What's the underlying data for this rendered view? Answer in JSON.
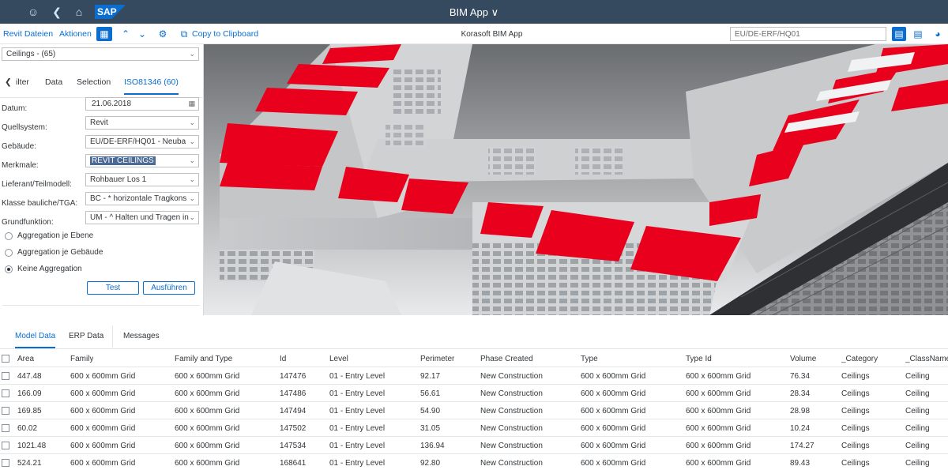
{
  "shell": {
    "app_title": "BIM App ∨",
    "logo": "SAP"
  },
  "toolbar": {
    "revit_files": "Revit Dateien",
    "actions": "Aktionen",
    "copy": "Copy to Clipboard",
    "center_title": "Korasoft BIM App",
    "search_value": "EU/DE-ERF/HQ01"
  },
  "left": {
    "category_select": "Ceilings - (65)",
    "tabs": [
      "ilter",
      "Data",
      "Selection",
      "ISO81346 (60)"
    ],
    "fields": [
      {
        "label": "Datum:",
        "value": "21.06.2018"
      },
      {
        "label": "Quellsystem:",
        "value": "Revit"
      },
      {
        "label": "Gebäude:",
        "value": "EU/DE-ERF/HQ01 - Neuba"
      },
      {
        "label": "Merkmale:",
        "value": "REVIT CEILINGS"
      },
      {
        "label": "Lieferant/Teilmodell:",
        "value": "Rohbauer Los 1"
      },
      {
        "label": "Klasse bauliche/TGA:",
        "value": "BC - * horizontale Tragkons"
      },
      {
        "label": "Grundfunktion:",
        "value": "UM - ^ Halten und Tragen in"
      }
    ],
    "radios": [
      "Aggregation je Ebene",
      "Aggregation je Gebäude",
      "Keine Aggregation"
    ],
    "buttons": {
      "test": "Test",
      "run": "Ausführen"
    }
  },
  "bottom": {
    "tabs": [
      "Model Data",
      "ERP Data",
      "Messages"
    ],
    "columns": [
      "Area",
      "Family",
      "Family and Type",
      "Id",
      "Level",
      "Perimeter",
      "Phase Created",
      "Type",
      "Type Id",
      "Volume",
      "_Category",
      "_ClassName"
    ],
    "rows": [
      [
        "447.48",
        "600 x 600mm Grid",
        "600 x 600mm Grid",
        "147476",
        "01 - Entry Level",
        "92.17",
        "New Construction",
        "600 x 600mm Grid",
        "600 x 600mm Grid",
        "76.34",
        "Ceilings",
        "Ceiling"
      ],
      [
        "166.09",
        "600 x 600mm Grid",
        "600 x 600mm Grid",
        "147486",
        "01 - Entry Level",
        "56.61",
        "New Construction",
        "600 x 600mm Grid",
        "600 x 600mm Grid",
        "28.34",
        "Ceilings",
        "Ceiling"
      ],
      [
        "169.85",
        "600 x 600mm Grid",
        "600 x 600mm Grid",
        "147494",
        "01 - Entry Level",
        "54.90",
        "New Construction",
        "600 x 600mm Grid",
        "600 x 600mm Grid",
        "28.98",
        "Ceilings",
        "Ceiling"
      ],
      [
        "60.02",
        "600 x 600mm Grid",
        "600 x 600mm Grid",
        "147502",
        "01 - Entry Level",
        "31.05",
        "New Construction",
        "600 x 600mm Grid",
        "600 x 600mm Grid",
        "10.24",
        "Ceilings",
        "Ceiling"
      ],
      [
        "1021.48",
        "600 x 600mm Grid",
        "600 x 600mm Grid",
        "147534",
        "01 - Entry Level",
        "136.94",
        "New Construction",
        "600 x 600mm Grid",
        "600 x 600mm Grid",
        "174.27",
        "Ceilings",
        "Ceiling"
      ],
      [
        "524.21",
        "600 x 600mm Grid",
        "600 x 600mm Grid",
        "168641",
        "01 - Entry Level",
        "92.80",
        "New Construction",
        "600 x 600mm Grid",
        "600 x 600mm Grid",
        "89.43",
        "Ceilings",
        "Ceiling"
      ]
    ]
  },
  "colors": {
    "shell": "#354a5f",
    "accent": "#0a6ed1",
    "highlight": "#e8001c"
  },
  "icons": [
    "user-icon",
    "back-icon",
    "home-icon",
    "grid-icon",
    "chevron-up-icon",
    "chevron-down-icon",
    "settings-icon",
    "copy-icon",
    "calendar-icon",
    "report-icon",
    "list-icon",
    "pie-icon"
  ]
}
